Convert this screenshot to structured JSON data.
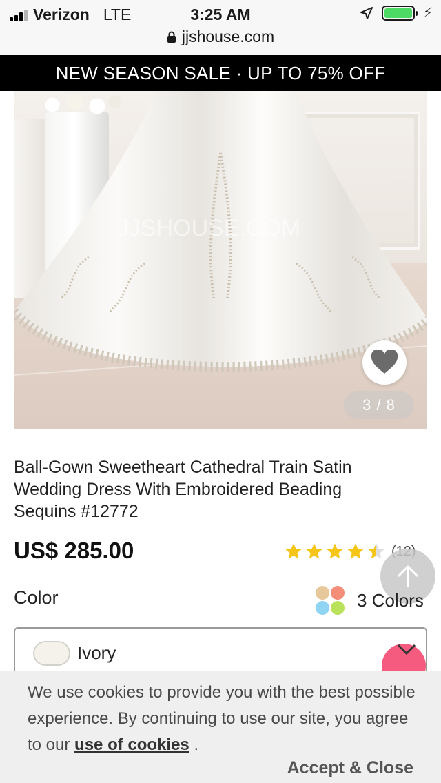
{
  "status_bar": {
    "carrier": "Verizon",
    "network": "LTE",
    "time": "3:25 AM",
    "url": "jjshouse.com",
    "battery_level": 1.0,
    "signal_bars": 3,
    "signal_max": 4
  },
  "promo_banner": {
    "text": "NEW SEASON SALE · UP TO 75% OFF"
  },
  "gallery": {
    "counter": "3 / 8",
    "watermark": "JJSHOUSE.COM"
  },
  "product": {
    "title": "Ball-Gown Sweetheart Cathedral Train Satin Wedding Dress With Embroidered Beading Sequins #12772",
    "price": "US$ 285.00",
    "rating": 4.5,
    "rating_max": 5,
    "review_count": "(12)"
  },
  "color_option": {
    "label": "Color",
    "colors_count": "3 Colors",
    "selected": "Ivory",
    "selected_swatch": "#f4f2ea"
  },
  "cookie_notice": {
    "text_before": "We use cookies to provide you with the best possible experience. By continuing to use our site, you agree to our ",
    "link": "use of cookies",
    "text_after": " .",
    "accept": "Accept & Close"
  },
  "colors": {
    "banner_bg": "#000000",
    "star": "#f5c518",
    "chat": "#f45b7e",
    "battery": "#4cd964"
  },
  "icons": [
    "location-arrow-icon",
    "lock-icon",
    "heart-icon",
    "star-icon",
    "arrow-up-icon",
    "palette-icon",
    "close-icon"
  ]
}
